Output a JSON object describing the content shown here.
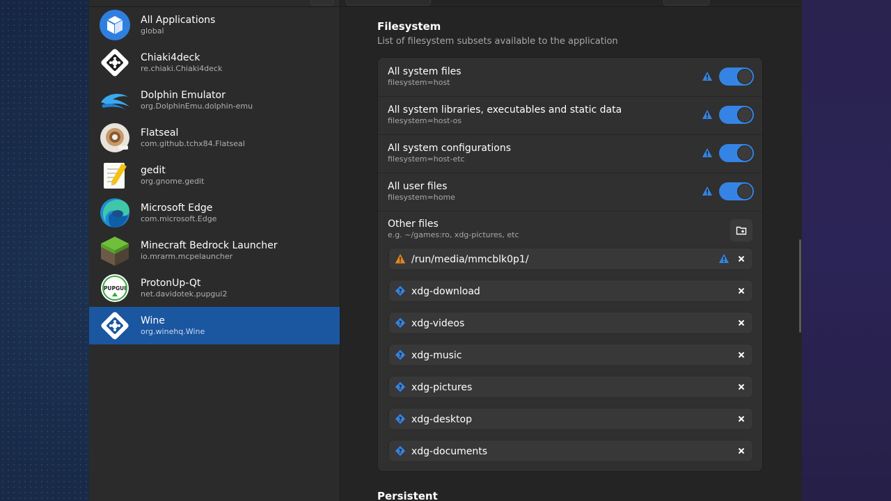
{
  "apps": [
    {
      "name": "All Applications",
      "id": "global",
      "icon": "all-applications-icon"
    },
    {
      "name": "Chiaki4deck",
      "id": "re.chiaki.Chiaki4deck",
      "icon": "chiaki4deck-icon"
    },
    {
      "name": "Dolphin Emulator",
      "id": "org.DolphinEmu.dolphin-emu",
      "icon": "dolphin-icon"
    },
    {
      "name": "Flatseal",
      "id": "com.github.tchx84.Flatseal",
      "icon": "flatseal-icon"
    },
    {
      "name": "gedit",
      "id": "org.gnome.gedit",
      "icon": "gedit-icon"
    },
    {
      "name": "Microsoft Edge",
      "id": "com.microsoft.Edge",
      "icon": "edge-icon"
    },
    {
      "name": "Minecraft Bedrock Launcher",
      "id": "io.mrarm.mcpelauncher",
      "icon": "minecraft-icon"
    },
    {
      "name": "ProtonUp-Qt",
      "id": "net.davidotek.pupgui2",
      "icon": "protonup-icon",
      "icon_text": "PUPGUI"
    },
    {
      "name": "Wine",
      "id": "org.winehq.Wine",
      "icon": "wine-icon",
      "selected": true
    }
  ],
  "filesystem": {
    "title": "Filesystem",
    "subtitle": "List of filesystem subsets available to the application",
    "permissions": [
      {
        "label": "All system files",
        "desc": "filesystem=host",
        "enabled": true
      },
      {
        "label": "All system libraries, executables and static data",
        "desc": "filesystem=host-os",
        "enabled": true
      },
      {
        "label": "All system configurations",
        "desc": "filesystem=host-etc",
        "enabled": true
      },
      {
        "label": "All user files",
        "desc": "filesystem=home",
        "enabled": true
      }
    ],
    "other": {
      "label": "Other files",
      "desc": "e.g. ~/games:ro, xdg-pictures, etc",
      "paths": [
        {
          "path": "/run/media/mmcblk0p1/",
          "icon": "warning-icon",
          "warn": true
        },
        {
          "path": "xdg-download",
          "icon": "question-icon"
        },
        {
          "path": "xdg-videos",
          "icon": "question-icon"
        },
        {
          "path": "xdg-music",
          "icon": "question-icon"
        },
        {
          "path": "xdg-pictures",
          "icon": "question-icon"
        },
        {
          "path": "xdg-desktop",
          "icon": "question-icon"
        },
        {
          "path": "xdg-documents",
          "icon": "question-icon"
        }
      ]
    }
  },
  "persistent": {
    "title": "Persistent"
  },
  "colors": {
    "accent": "#3584e4",
    "selection": "#1b56a0",
    "warning": "#e5871a"
  }
}
